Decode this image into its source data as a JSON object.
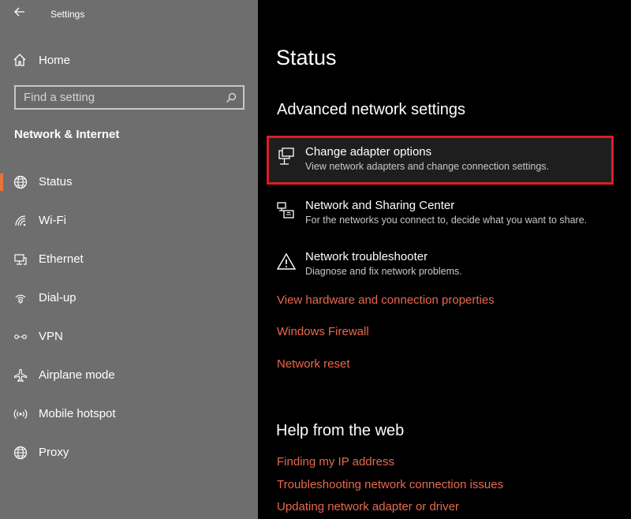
{
  "window": {
    "title": "Settings"
  },
  "sidebar": {
    "home_label": "Home",
    "search_placeholder": "Find a setting",
    "section_title": "Network & Internet",
    "items": [
      {
        "label": "Status",
        "icon": "globe-icon",
        "active": true
      },
      {
        "label": "Wi-Fi",
        "icon": "wifi-icon",
        "active": false
      },
      {
        "label": "Ethernet",
        "icon": "ethernet-icon",
        "active": false
      },
      {
        "label": "Dial-up",
        "icon": "dialup-icon",
        "active": false
      },
      {
        "label": "VPN",
        "icon": "vpn-icon",
        "active": false
      },
      {
        "label": "Airplane mode",
        "icon": "airplane-icon",
        "active": false
      },
      {
        "label": "Mobile hotspot",
        "icon": "hotspot-icon",
        "active": false
      },
      {
        "label": "Proxy",
        "icon": "globe-icon",
        "active": false
      }
    ]
  },
  "main": {
    "page_title": "Status",
    "advanced_title": "Advanced network settings",
    "options": [
      {
        "title": "Change adapter options",
        "description": "View network adapters and change connection settings.",
        "icon": "adapter-icon",
        "highlighted": true
      },
      {
        "title": "Network and Sharing Center",
        "description": "For the networks you connect to, decide what you want to share.",
        "icon": "sharing-center-icon",
        "highlighted": false
      },
      {
        "title": "Network troubleshooter",
        "description": "Diagnose and fix network problems.",
        "icon": "warning-icon",
        "highlighted": false
      }
    ],
    "links": [
      "View hardware and connection properties",
      "Windows Firewall",
      "Network reset"
    ],
    "help_title": "Help from the web",
    "help_links": [
      "Finding my IP address",
      "Troubleshooting network connection issues",
      "Updating network adapter or driver"
    ]
  },
  "colors": {
    "sidebar_bg": "#6e6e6e",
    "main_bg": "#000000",
    "accent_link": "#e9684f",
    "highlight_border": "#d91e28",
    "active_indicator": "#e8743b"
  }
}
